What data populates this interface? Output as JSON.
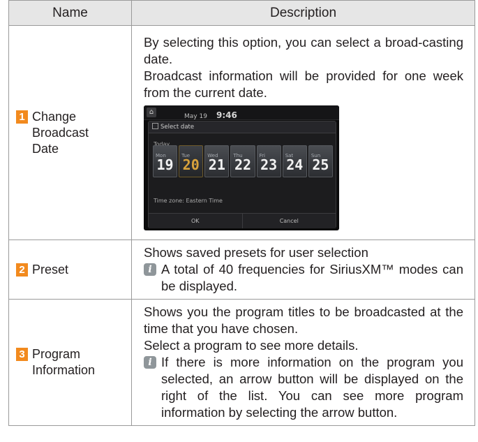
{
  "table": {
    "header": {
      "name": "Name",
      "description": "Description"
    },
    "rows": [
      {
        "number": "1",
        "name_lines": [
          "Change",
          "Broadcast",
          "Date"
        ],
        "paragraphs": [
          "By selecting this option, you can select a broad-casting date.",
          "Broadcast information will be provided for one week from the current date."
        ],
        "screen": {
          "date": "May 19",
          "time": "9:46",
          "dialog_title": "Select date",
          "today_label": "Today",
          "days": [
            {
              "name": "Mon",
              "date": "19",
              "selected": false
            },
            {
              "name": "Tue",
              "date": "20",
              "selected": true
            },
            {
              "name": "Wed",
              "date": "21",
              "selected": false
            },
            {
              "name": "Thu",
              "date": "22",
              "selected": false
            },
            {
              "name": "Fri",
              "date": "23",
              "selected": false
            },
            {
              "name": "Sat",
              "date": "24",
              "selected": false
            },
            {
              "name": "Sun",
              "date": "25",
              "selected": false
            }
          ],
          "time_zone": "Time zone: Eastern Time",
          "ok_label": "OK",
          "cancel_label": "Cancel"
        }
      },
      {
        "number": "2",
        "name_lines": [
          "Preset"
        ],
        "paragraphs": [
          "Shows saved presets for user selection"
        ],
        "note": "A total of 40 frequencies for SiriusXM™ modes can be displayed."
      },
      {
        "number": "3",
        "name_lines": [
          "Program",
          "Information"
        ],
        "paragraphs": [
          "Shows you the program titles to be broadcasted at the time that you have chosen.",
          "Select a program to see more details."
        ],
        "note": "If there is more information on the program you selected, an arrow button will be displayed on the right of the list. You can see more program information by selecting the arrow button."
      }
    ]
  },
  "icons": {
    "info": "info-icon",
    "home": "home-icon"
  },
  "colors": {
    "badge": "#f28a1e",
    "header_bg": "#e6e6e6",
    "info_icon": "#8f969a",
    "selected_day": "#d8a23c"
  }
}
